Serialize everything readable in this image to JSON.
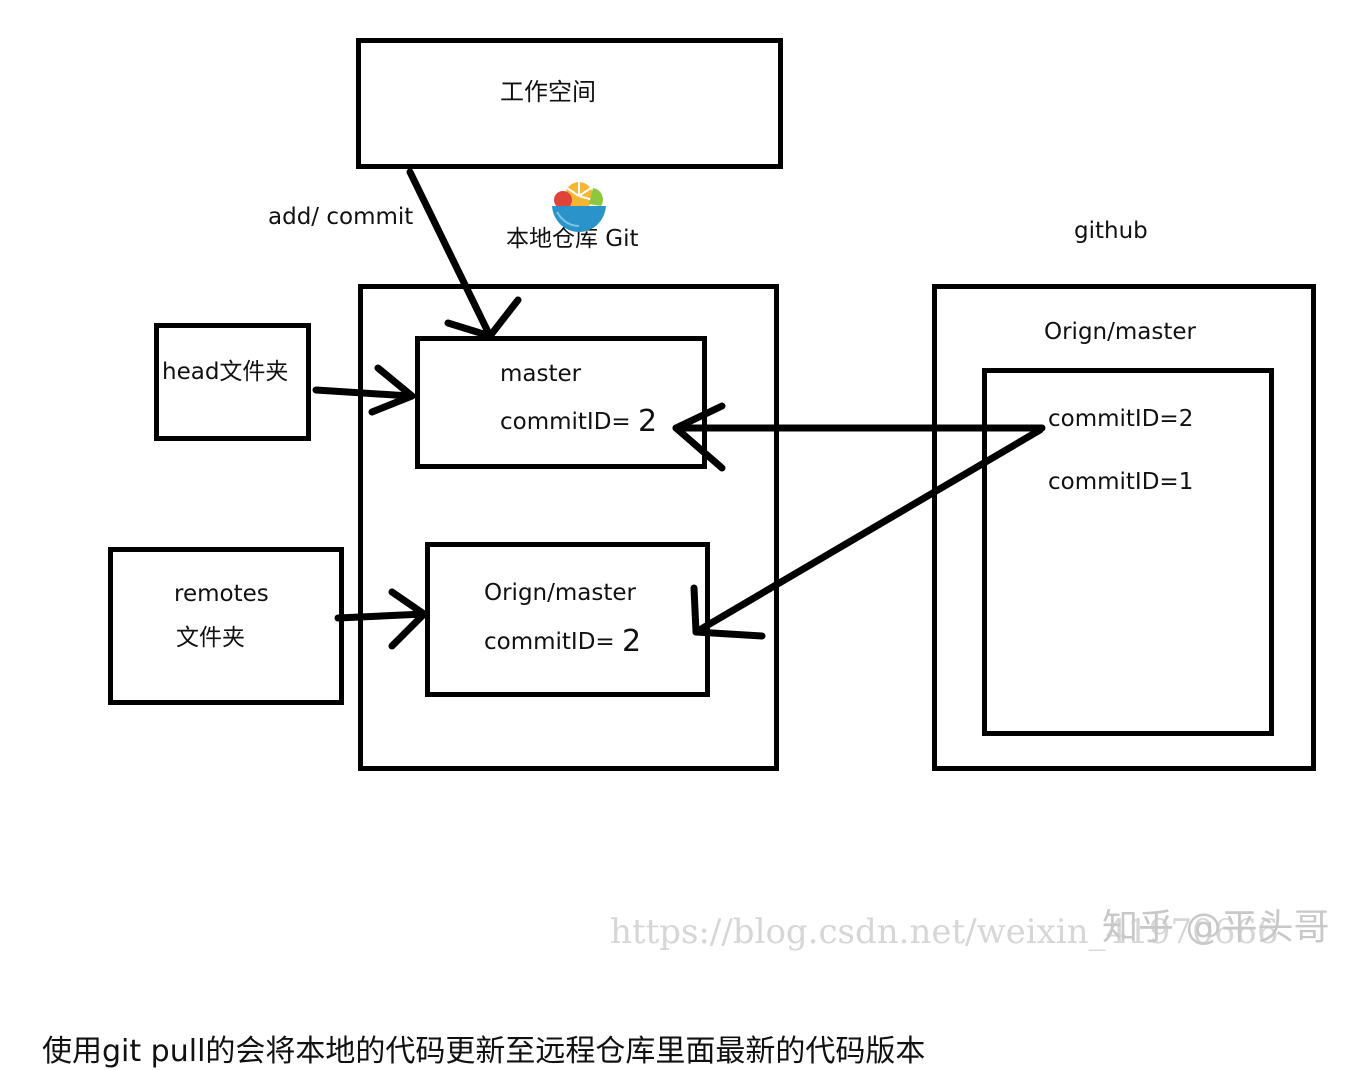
{
  "diagram": {
    "workspace": {
      "label": "工作空间"
    },
    "add_commit": {
      "label": "add/ commit"
    },
    "local_repo": {
      "label": "本地仓库 Git"
    },
    "github": {
      "label": "github"
    },
    "head_folder": {
      "label": "head文件夹"
    },
    "remotes_folder": {
      "line1": "remotes",
      "line2": "文件夹"
    },
    "local_master": {
      "name": "master",
      "commit_prefix": "commitID=",
      "commit_value": "2"
    },
    "local_origin_master": {
      "name": "Orign/master",
      "commit_prefix": "commitID=",
      "commit_value": "2"
    },
    "remote": {
      "title": "Orign/master",
      "commits": [
        "commitID=2",
        "commitID=1"
      ]
    }
  },
  "watermark": {
    "url": "https://blog.csdn.net/weixin_41970666",
    "zhihu": "知乎 @平头哥"
  },
  "caption": "使用git pull的会将本地的代码更新至远程仓库里面最新的代码版本",
  "icon": {
    "name": "fruit-bowl-icon",
    "colors": [
      "#e0433a",
      "#f5b733",
      "#8dc63f",
      "#2a93c9"
    ]
  }
}
